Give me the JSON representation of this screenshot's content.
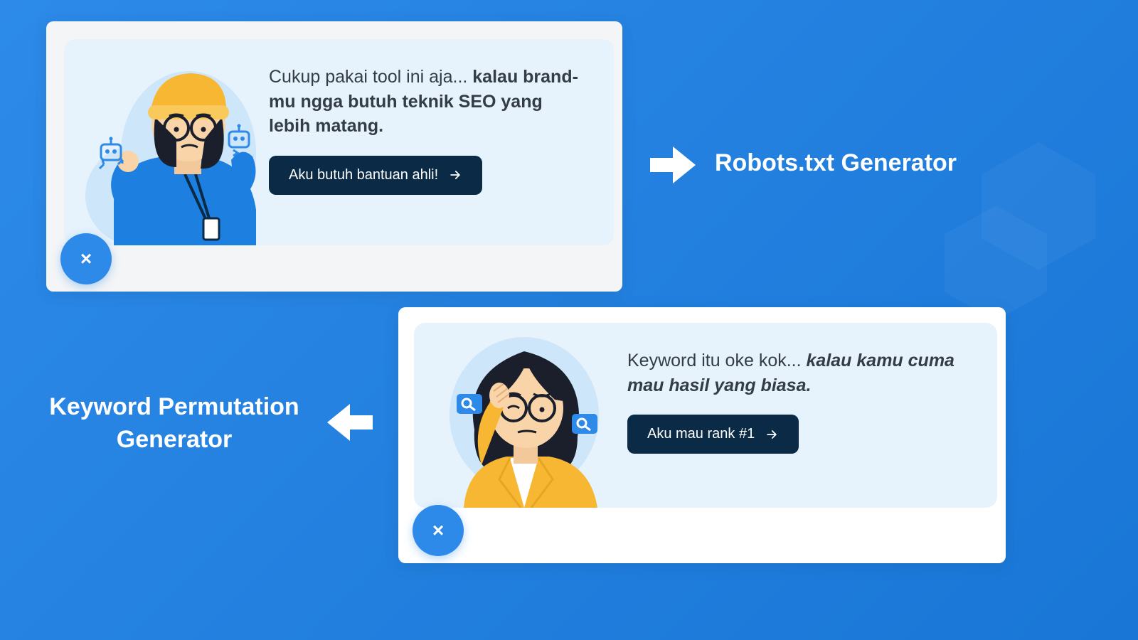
{
  "card1": {
    "headline_plain": "Cukup pakai tool ini aja... ",
    "headline_bold": "kalau brand-mu ngga butuh teknik SEO yang lebih matang.",
    "cta": "Aku butuh bantuan ahli!",
    "icon": "arrow-right",
    "close": "×"
  },
  "card2": {
    "headline_plain": "Keyword itu oke kok... ",
    "headline_italic_bold": "kalau kamu cuma mau hasil yang biasa.",
    "cta": "Aku mau rank #1",
    "icon": "arrow-right",
    "close": "×"
  },
  "labels": {
    "right": "Robots.txt Generator",
    "left": "Keyword Permutation Generator"
  },
  "colors": {
    "bg_from": "#2d8ae8",
    "bg_to": "#1976d6",
    "card_inner": "#e6f2fc",
    "cta_bg": "#0a2a45",
    "accent": "#2d8ae8"
  }
}
